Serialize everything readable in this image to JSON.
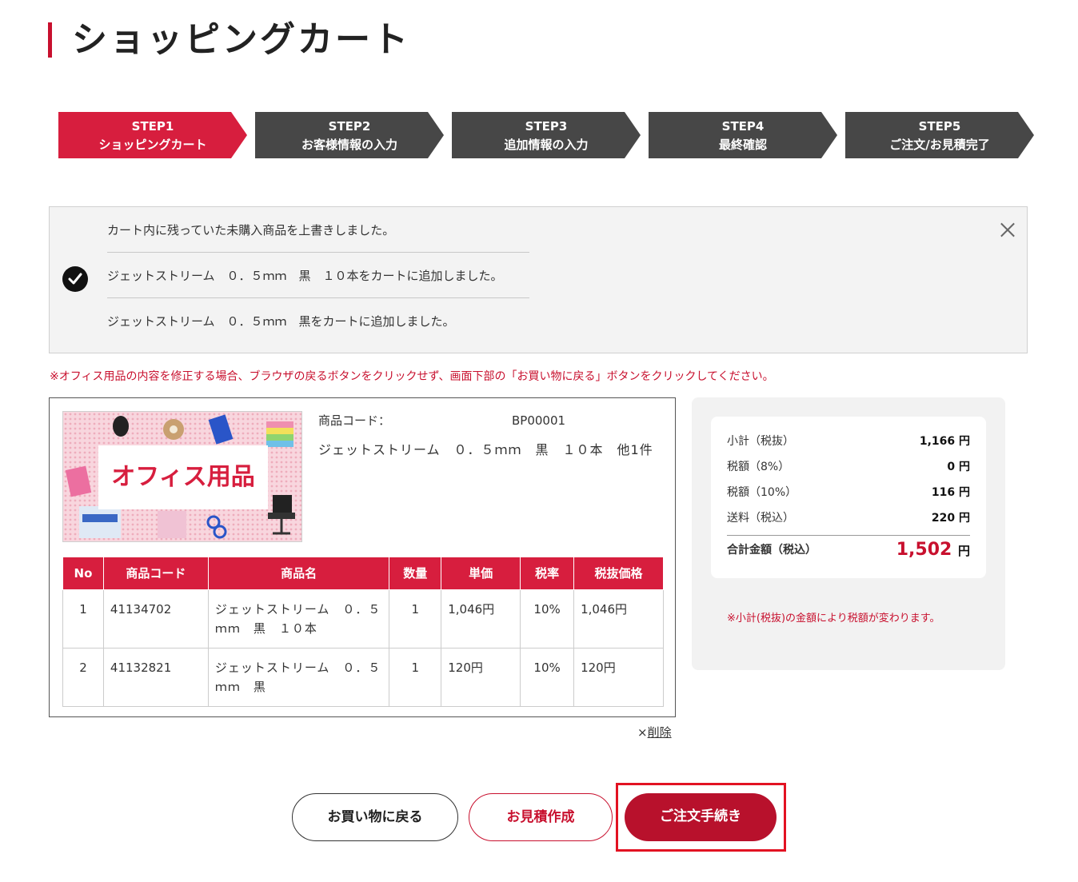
{
  "page": {
    "title": "ショッピングカート"
  },
  "colors": {
    "accent": "#d71e3e",
    "step_active": "#d71e3e",
    "step_inactive": "#474747",
    "order_button": "#b8112c"
  },
  "steps": [
    {
      "step": "STEP1",
      "label": "ショッピングカート",
      "active": true
    },
    {
      "step": "STEP2",
      "label": "お客様情報の入力",
      "active": false
    },
    {
      "step": "STEP3",
      "label": "追加情報の入力",
      "active": false
    },
    {
      "step": "STEP4",
      "label": "最終確認",
      "active": false
    },
    {
      "step": "STEP5",
      "label": "ご注文/お見積完了",
      "active": false
    }
  ],
  "notice": {
    "icon": "check-circle-icon",
    "messages": [
      "カート内に残っていた未購入商品を上書きしました。",
      "ジェットストリーム　０．５ｍｍ　黒　１０本をカートに追加しました。",
      "ジェットストリーム　０．５ｍｍ　黒をカートに追加しました。"
    ]
  },
  "warning": "※オフィス用品の内容を修正する場合、ブラウザの戻るボタンをクリックせず、画面下部の「お買い物に戻る」ボタンをクリックしてください。",
  "product": {
    "banner_text": "オフィス用品",
    "code_label": "商品コード：",
    "code_value": "BP00001",
    "name": "ジェットストリーム　０．５ｍｍ　黒　１０本　他1件"
  },
  "table": {
    "headers": [
      "No",
      "商品コード",
      "商品名",
      "数量",
      "単価",
      "税率",
      "税抜価格"
    ],
    "rows": [
      [
        "1",
        "41134702",
        "ジェットストリーム　０．５ｍｍ　黒　１０本",
        "1",
        "1,046円",
        "10%",
        "1,046円"
      ],
      [
        "2",
        "41132821",
        "ジェットストリーム　０．５ｍｍ　黒",
        "1",
        "120円",
        "10%",
        "120円"
      ]
    ]
  },
  "delete_prefix": "×",
  "delete_label": "削除",
  "summary": {
    "rows": [
      {
        "label": "小計（税抜）",
        "value": "1,166 円"
      },
      {
        "label": "税額（8%）",
        "value": "0 円"
      },
      {
        "label": "税額（10%）",
        "value": "116 円"
      },
      {
        "label": "送料（税込）",
        "value": "220 円"
      }
    ],
    "total_label": "合計金額（税込）",
    "total_value": "1,502",
    "total_unit": "円",
    "note": "※小計(税抜)の金額により税額が変わります。"
  },
  "buttons": {
    "back": "お買い物に戻る",
    "quote": "お見積作成",
    "order": "ご注文手続き"
  }
}
